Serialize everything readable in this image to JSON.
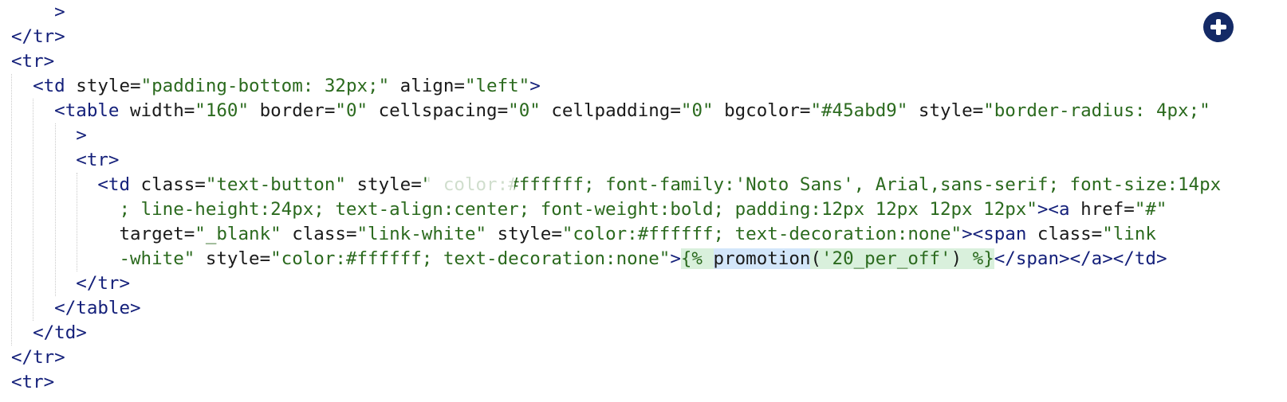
{
  "editor": {
    "lines": [
      {
        "tokens": [
          {
            "t": "    >",
            "c": "tag"
          }
        ]
      },
      {
        "tokens": [
          {
            "t": "</tr>",
            "c": "tag"
          }
        ]
      },
      {
        "tokens": [
          {
            "t": "<tr>",
            "c": "tag"
          }
        ]
      },
      {
        "tokens": [
          {
            "t": "  <td",
            "c": "tag"
          },
          {
            "t": " style",
            "c": "attr"
          },
          {
            "t": "=",
            "c": "eq"
          },
          {
            "t": "\"padding-bottom: 32px;\"",
            "c": "val"
          },
          {
            "t": " align",
            "c": "attr"
          },
          {
            "t": "=",
            "c": "eq"
          },
          {
            "t": "\"left\"",
            "c": "val"
          },
          {
            "t": ">",
            "c": "tag"
          }
        ]
      },
      {
        "tokens": [
          {
            "t": "    <table",
            "c": "tag"
          },
          {
            "t": " width",
            "c": "attr"
          },
          {
            "t": "=",
            "c": "eq"
          },
          {
            "t": "\"160\"",
            "c": "val"
          },
          {
            "t": " border",
            "c": "attr"
          },
          {
            "t": "=",
            "c": "eq"
          },
          {
            "t": "\"0\"",
            "c": "val"
          },
          {
            "t": " cellspacing",
            "c": "attr"
          },
          {
            "t": "=",
            "c": "eq"
          },
          {
            "t": "\"0\"",
            "c": "val"
          },
          {
            "t": " cellpadding",
            "c": "attr"
          },
          {
            "t": "=",
            "c": "eq"
          },
          {
            "t": "\"0\"",
            "c": "val"
          },
          {
            "t": " bgcolor",
            "c": "attr"
          },
          {
            "t": "=",
            "c": "eq"
          },
          {
            "t": "\"#45abd9\"",
            "c": "val"
          },
          {
            "t": " style",
            "c": "attr"
          },
          {
            "t": "=",
            "c": "eq"
          },
          {
            "t": "\"border-radius: 4px;\"",
            "c": "val"
          }
        ]
      },
      {
        "tokens": [
          {
            "t": "      >",
            "c": "tag"
          }
        ]
      },
      {
        "tokens": [
          {
            "t": "      <tr>",
            "c": "tag"
          }
        ]
      },
      {
        "tokens": [
          {
            "t": "        <td",
            "c": "tag"
          },
          {
            "t": " class",
            "c": "attr"
          },
          {
            "t": "=",
            "c": "eq"
          },
          {
            "t": "\"text-button\"",
            "c": "val"
          },
          {
            "t": " style",
            "c": "attr"
          },
          {
            "t": "=",
            "c": "eq"
          },
          {
            "t": "\" color:#ffffff; font-family:'Noto Sans', Arial,sans-serif; font-size:14px",
            "c": "val"
          }
        ]
      },
      {
        "tokens": [
          {
            "t": "          ; line-height:24px; text-align:center; font-weight:bold; padding:12px 12px 12px 12px\"",
            "c": "val"
          },
          {
            "t": "><a",
            "c": "tag"
          },
          {
            "t": " href",
            "c": "attr"
          },
          {
            "t": "=",
            "c": "eq"
          },
          {
            "t": "\"#\"",
            "c": "val"
          }
        ]
      },
      {
        "tokens": [
          {
            "t": "          target",
            "c": "attr"
          },
          {
            "t": "=",
            "c": "eq"
          },
          {
            "t": "\"_blank\"",
            "c": "val"
          },
          {
            "t": " class",
            "c": "attr"
          },
          {
            "t": "=",
            "c": "eq"
          },
          {
            "t": "\"link-white\"",
            "c": "val"
          },
          {
            "t": " style",
            "c": "attr"
          },
          {
            "t": "=",
            "c": "eq"
          },
          {
            "t": "\"color:#ffffff; text-decoration:none\"",
            "c": "val"
          },
          {
            "t": "><span",
            "c": "tag"
          },
          {
            "t": " class",
            "c": "attr"
          },
          {
            "t": "=",
            "c": "eq"
          },
          {
            "t": "\"link",
            "c": "val"
          }
        ]
      },
      {
        "tokens": [
          {
            "t": "          -white\"",
            "c": "val"
          },
          {
            "t": " style",
            "c": "attr"
          },
          {
            "t": "=",
            "c": "eq"
          },
          {
            "t": "\"color:#ffffff; text-decoration:none\"",
            "c": "val"
          },
          {
            "t": ">",
            "c": "tag"
          },
          {
            "t": "{% ",
            "c": "tpl-delim tpl-hl"
          },
          {
            "t": "promotion",
            "c": "tpl-fn tpl-fn-hl"
          },
          {
            "t": "(",
            "c": "tpl-fn tpl-hl"
          },
          {
            "t": "'20_per_off'",
            "c": "tpl-str tpl-hl"
          },
          {
            "t": ") ",
            "c": "tpl-fn tpl-hl"
          },
          {
            "t": "%}",
            "c": "tpl-delim tpl-hl"
          },
          {
            "t": "</span></a></td>",
            "c": "tag"
          }
        ]
      },
      {
        "tokens": [
          {
            "t": "      </tr>",
            "c": "tag"
          }
        ]
      },
      {
        "tokens": [
          {
            "t": "    </table>",
            "c": "tag"
          }
        ]
      },
      {
        "tokens": [
          {
            "t": "  </td>",
            "c": "tag"
          }
        ]
      },
      {
        "tokens": [
          {
            "t": "</tr>",
            "c": "tag"
          }
        ]
      },
      {
        "tokens": [
          {
            "t": "<tr>",
            "c": "tag"
          }
        ]
      }
    ]
  },
  "add_button": {
    "icon": "plus-circle-icon",
    "color": "#142a66"
  }
}
